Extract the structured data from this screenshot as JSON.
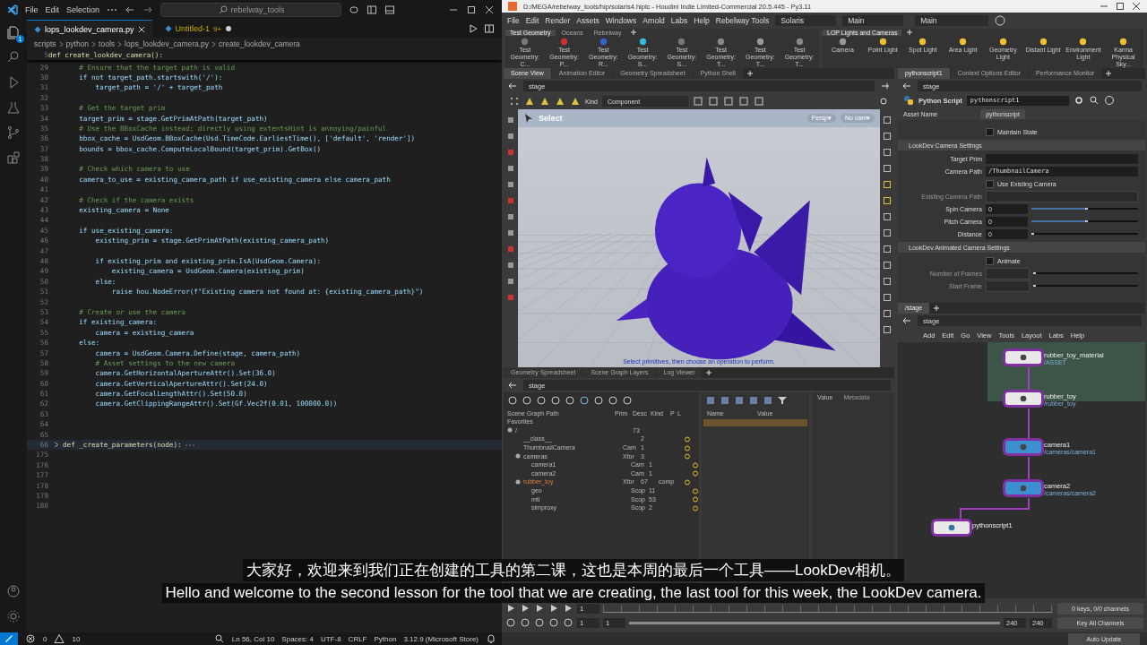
{
  "vscode": {
    "menu": [
      "File",
      "Edit",
      "Selection"
    ],
    "search": "rebelway_tools",
    "explorer_badge": "1",
    "tabs": [
      {
        "label": "lops_lookdev_camera.py",
        "selected": true,
        "modified": false
      },
      {
        "label": "Untitled-1",
        "badge": "9+",
        "selected": false,
        "modified": true
      }
    ],
    "breadcrumb": [
      "scripts",
      "python",
      "tools",
      "lops_lookdev_camera.py",
      "create_lookdev_camera"
    ],
    "sticky": {
      "num": "5",
      "text": "def create_lookdev_camera():"
    },
    "lines": [
      {
        "num": "29",
        "kind": "comment",
        "text": "    # Ensure that the target path is valid"
      },
      {
        "num": "30",
        "kind": "code",
        "text": "    if not target_path.startswith('/'):"
      },
      {
        "num": "31",
        "kind": "code",
        "text": "        target_path = '/' + target_path"
      },
      {
        "num": "32",
        "kind": "code"
      },
      {
        "num": "33",
        "kind": "comment",
        "text": "    # Get the target prim"
      },
      {
        "num": "34",
        "kind": "code",
        "text": "    target_prim = stage.GetPrimAtPath(target_path)"
      },
      {
        "num": "35",
        "kind": "comment",
        "text": "    # Use the BBoxCache instead; directly using extentsHint is annoying/painful"
      },
      {
        "num": "36",
        "kind": "code",
        "text": "    bbox_cache = UsdGeom.BBoxCache(Usd.TimeCode.EarliestTime(), ['default', 'render'])"
      },
      {
        "num": "37",
        "kind": "code",
        "text": "    bounds = bbox_cache.ComputeLocalBound(target_prim).GetBox()"
      },
      {
        "num": "38",
        "kind": "code"
      },
      {
        "num": "39",
        "kind": "comment",
        "text": "    # Check which camera to use"
      },
      {
        "num": "40",
        "kind": "code",
        "text": "    camera_to_use = existing_camera_path if use_existing_camera else camera_path"
      },
      {
        "num": "41",
        "kind": "code"
      },
      {
        "num": "42",
        "kind": "comment",
        "text": "    # Check if the camera exists"
      },
      {
        "num": "43",
        "kind": "code",
        "text": "    existing_camera = None"
      },
      {
        "num": "44",
        "kind": "code"
      },
      {
        "num": "45",
        "kind": "code",
        "text": "    if use_existing_camera:"
      },
      {
        "num": "46",
        "kind": "code",
        "text": "        existing_prim = stage.GetPrimAtPath(existing_camera_path)"
      },
      {
        "num": "47",
        "kind": "code"
      },
      {
        "num": "48",
        "kind": "code",
        "text": "        if existing_prim and existing_prim.IsA(UsdGeom.Camera):"
      },
      {
        "num": "49",
        "kind": "code",
        "text": "            existing_camera = UsdGeom.Camera(existing_prim)"
      },
      {
        "num": "50",
        "kind": "code",
        "text": "        else:"
      },
      {
        "num": "51",
        "kind": "code",
        "text": "            raise hou.NodeError(f\"Existing camera not found at: {existing_camera_path}\")"
      },
      {
        "num": "52",
        "kind": "code"
      },
      {
        "num": "53",
        "kind": "comment",
        "text": "    # Create or use the camera"
      },
      {
        "num": "54",
        "kind": "code",
        "text": "    if existing_camera:"
      },
      {
        "num": "55",
        "kind": "code",
        "text": "        camera = existing_camera"
      },
      {
        "num": "56",
        "kind": "code",
        "text": "    else:"
      },
      {
        "num": "57",
        "kind": "code",
        "text": "        camera = UsdGeom.Camera.Define(stage, camera_path)"
      },
      {
        "num": "58",
        "kind": "comment",
        "text": "        # Asset settings to the new camera"
      },
      {
        "num": "59",
        "kind": "code",
        "text": "        camera.GetHorizontalApertureAttr().Set(36.0)"
      },
      {
        "num": "60",
        "kind": "code",
        "text": "        camera.GetVerticalApertureAttr().Set(24.0)"
      },
      {
        "num": "61",
        "kind": "code",
        "text": "        camera.GetFocalLengthAttr().Set(50.0)"
      },
      {
        "num": "62",
        "kind": "code",
        "text": "        camera.GetClippingRangeAttr().Set(Gf.Vec2f(0.01, 100000.0))"
      },
      {
        "num": "63",
        "kind": "code"
      },
      {
        "num": "64",
        "kind": "code"
      },
      {
        "num": "65",
        "kind": "code"
      },
      {
        "num": "66",
        "kind": "folded",
        "text": "def _create_parameters(node):"
      },
      {
        "num": "175",
        "kind": "code"
      },
      {
        "num": "176",
        "kind": "code"
      },
      {
        "num": "177",
        "kind": "code"
      },
      {
        "num": "178",
        "kind": "code"
      },
      {
        "num": "179",
        "kind": "code"
      },
      {
        "num": "180",
        "kind": "code"
      }
    ],
    "status": {
      "errors": "0",
      "warnings": "10",
      "items": [
        "Ln 56, Col 10",
        "Spaces: 4",
        "UTF-8",
        "CRLF",
        "Python",
        "3.12.9 (Microsoft Store)"
      ]
    }
  },
  "houdini": {
    "title": "D:/MEGA/rebelway_tools/hip/solaris4.hiplc - Houdini Indie Limited-Commercial 20.5.445 - Py3.11",
    "menu": [
      "File",
      "Edit",
      "Render",
      "Assets",
      "Windows",
      "Arnold",
      "Labs",
      "Help",
      "Rebelway Tools"
    ],
    "desktop": "Solaris",
    "context": "Main",
    "context_right": "Main",
    "shelf_left": {
      "tabs": [
        {
          "label": "Test Geometry",
          "selected": true
        },
        {
          "label": "Oceans",
          "selected": false
        },
        {
          "label": "Rebelway",
          "selected": false
        }
      ],
      "tools": [
        "Test Geometry: C...",
        "Test Geometry: P...",
        "Test Geometry: R...",
        "Test Geometry: S...",
        "Test Geometry: S...",
        "Test Geometry: T...",
        "Test Geometry: T...",
        "Test Geometry: T..."
      ]
    },
    "shelf_right": {
      "tabs": [
        {
          "label": "LOP Lights and Cameras",
          "selected": true
        }
      ],
      "tools": [
        "Camera",
        "Point Light",
        "Spot Light",
        "Area Light",
        "Geometry Light",
        "Distant Light",
        "Environment Light",
        "Karma Physical Sky..."
      ]
    },
    "viewer": {
      "tabs": [
        {
          "label": "Scene View",
          "selected": true
        },
        {
          "label": "Animation Editor",
          "selected": false
        },
        {
          "label": "Geometry Spreadsheet",
          "selected": false
        },
        {
          "label": "Python Shell",
          "selected": false
        }
      ],
      "path": "stage",
      "kind_label": "Kind",
      "kind_value": "Component",
      "tool": "Select",
      "persp": "Persp▾",
      "cam": "No cam▾",
      "hint": "Select primitives, then choose an operation to perform."
    },
    "params": {
      "tabs": [
        {
          "label": "pythonscript1",
          "selected": true
        },
        {
          "label": "Context Options Editor",
          "selected": false
        },
        {
          "label": "Performance Monitor",
          "selected": false
        }
      ],
      "path": "stage",
      "node_type": "Python Script",
      "node_name": "pythonscript1",
      "asset_label": "Asset Name",
      "asset_value": "pythonscript",
      "items": [
        {
          "kind": "checkbox",
          "label": "Maintain State",
          "checked": false,
          "disabled": false
        },
        {
          "kind": "section",
          "label": "LookDev Camera Settings"
        },
        {
          "kind": "text",
          "label": "Target Prim",
          "disabled": false
        },
        {
          "kind": "text",
          "label": "Camera Path",
          "value": "/ThumbnailCamera",
          "disabled": false
        },
        {
          "kind": "checkbox",
          "label": "Use Existing Camera",
          "checked": false,
          "disabled": false
        },
        {
          "kind": "text",
          "label": "Existing Camera Path",
          "disabled": true
        },
        {
          "kind": "slider",
          "label": "Spin Camera",
          "value": "0",
          "level": 0.5,
          "disabled": false
        },
        {
          "kind": "slider",
          "label": "Pitch Camera",
          "value": "0",
          "level": 0.5,
          "disabled": false
        },
        {
          "kind": "slider",
          "label": "Distance",
          "value": "0",
          "level": 0,
          "disabled": false
        },
        {
          "kind": "section",
          "label": "LookDev Animated Camera Settings"
        },
        {
          "kind": "checkbox",
          "label": "Animate",
          "checked": false,
          "disabled": false
        },
        {
          "kind": "slider",
          "label": "Number of Frames",
          "level": 0,
          "disabled": true
        },
        {
          "kind": "slider",
          "label": "Start Frame",
          "level": 0,
          "disabled": true
        }
      ]
    },
    "network": {
      "tab": "/stage",
      "path": "stage",
      "menu": [
        "Add",
        "Edit",
        "Go",
        "View",
        "Tools",
        "Layout",
        "Labs",
        "Help"
      ],
      "nodes": [
        {
          "kind": "asset",
          "name": "rubber_toy_material",
          "sub": "/ASSET"
        },
        {
          "kind": "asset",
          "name": "rubber_toy",
          "sub": "/rubber_toy"
        },
        {
          "kind": "camera",
          "name": "camera1",
          "sub": "/cameras/camera1"
        },
        {
          "kind": "camera",
          "name": "camera2",
          "sub": "/cameras/camera2"
        },
        {
          "kind": "python",
          "name": "pythonscript1"
        }
      ]
    },
    "scene_graph": {
      "tabs": [
        {
          "label": "Geometry Spreadsheet",
          "selected": false
        },
        {
          "label": "Scene Graph Layers",
          "selected": false
        },
        {
          "label": "Log Viewer",
          "selected": false
        }
      ],
      "path": "stage",
      "columns": [
        "Scene Graph Path",
        "Prim",
        "Desc",
        "Kind",
        "P",
        "L"
      ],
      "favorites": "Favorites",
      "tree": [
        {
          "name": "/",
          "desc": "73",
          "children": [
            {
              "name": "__class__",
              "desc": "2"
            },
            {
              "name": "ThumbnailCamera",
              "prim": "Cam",
              "desc": "1"
            },
            {
              "name": "cameras",
              "prim": "Xfor",
              "desc": "3",
              "children": [
                {
                  "name": "camera1",
                  "prim": "Cam",
                  "desc": "1"
                },
                {
                  "name": "camera2",
                  "prim": "Cam",
                  "desc": "1"
                }
              ]
            },
            {
              "name": "rubber_toy",
              "prim": "Xfor",
              "desc": "67",
              "kind": "comp",
              "children": [
                {
                  "name": "geo",
                  "prim": "Scop",
                  "desc": "11"
                },
                {
                  "name": "mtl",
                  "prim": "Scop",
                  "desc": "53"
                },
                {
                  "name": "simproxy",
                  "prim": "Scop",
                  "desc": "2"
                }
              ]
            }
          ]
        }
      ],
      "detail_columns": [
        "Name",
        "Value"
      ],
      "value_tabs": [
        "Value",
        "Metadata"
      ]
    },
    "timeline": {
      "frame": "1",
      "start": "1",
      "start2": "1",
      "end": "240",
      "end2": "240",
      "range": {
        "level": 1
      },
      "keys": "0 keys, 0/0 channels",
      "key_all": "Key All Channels",
      "auto_update": "Auto Update"
    }
  },
  "subtitles": [
    "大家好，欢迎来到我们正在创建的工具的第二课，这也是本周的最后一个工具——LookDev相机。",
    "Hello and welcome to the second lesson for the tool that we are creating, the last tool for this week, the LookDev camera."
  ]
}
